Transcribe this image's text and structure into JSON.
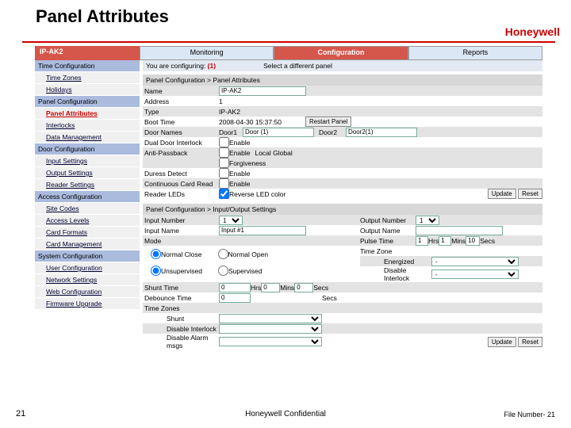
{
  "slide": {
    "title": "Panel Attributes",
    "brand": "Honeywell"
  },
  "topbar": {
    "ip": "IP-AK2",
    "monitoring": "Monitoring",
    "configuration": "Configuration",
    "reports": "Reports"
  },
  "sidebar": {
    "sec_time": "Time Configuration",
    "time_zones": "Time Zones",
    "holidays": "Holidays",
    "sec_panel": "Panel Configuration",
    "panel_attr": "Panel Attributes",
    "interlocks": "Interlocks",
    "data_mgmt": "Data Management",
    "sec_door": "Door Configuration",
    "input_settings": "Input Settings",
    "output_settings": "Output Settings",
    "reader_settings": "Reader Settings",
    "sec_access": "Access Configuration",
    "site_codes": "Site Codes",
    "access_levels": "Access Levels",
    "card_formats": "Card Formats",
    "card_mgmt": "Card Management",
    "sec_system": "System Configuration",
    "user_cfg": "User Configuration",
    "network": "Network Settings",
    "web_cfg": "Web Configuration",
    "firmware": "Firmware Upgrade"
  },
  "main": {
    "cfg_prefix": "You are configuring:",
    "cfg_id": "(1)",
    "select_diff": "Select a different panel",
    "crumb1": "Panel Configuration > Panel Attributes",
    "name_lbl": "Name",
    "name_val": "IP-AK2",
    "address_lbl": "Address",
    "address_val": "1",
    "type_lbl": "Type",
    "type_val": "IP-AK2",
    "boot_lbl": "Boot Time",
    "boot_val": "2008-04-30 15:37:50",
    "restart_btn": "Restart Panel",
    "doornames_lbl": "Door Names",
    "door1_lbl": "Door1",
    "door1_val": "Door (1)",
    "door2_lbl": "Door2",
    "door2_val": "Door2(1)",
    "dualdoor_lbl": "Dual Door Interlock",
    "dualdoor_chk": "Enable",
    "anti_lbl": "Anti-Passback",
    "anti_chk1": "Enable",
    "anti_chk2": "Forgiveness",
    "anti_sel": "Local   Global",
    "duress_lbl": "Duress Detect",
    "duress_chk": "Enable",
    "cont_lbl": "Continuous Card Read",
    "cont_chk": "Enable",
    "leds_lbl": "Reader LEDs",
    "leds_chk": "Reverse LED color",
    "update_btn": "Update",
    "reset_btn": "Reset",
    "crumb2": "Panel Configuration > Input/Output Settings",
    "in_num_lbl": "Input Number",
    "in_num_val": "1",
    "in_name_lbl": "Input Name",
    "in_name_val": "Input #1",
    "mode_lbl": "Mode",
    "nc": "Normal Close",
    "no": "Normal Open",
    "unsup": "Unsupervised",
    "sup": "Supervised",
    "out_num_lbl": "Output Number",
    "out_num_val": "1",
    "out_name_lbl": "Output Name",
    "pulse_lbl": "Pulse Time",
    "pulse_hrs": "1",
    "pulse_hrs_u": "Hrs",
    "pulse_mins": "1",
    "pulse_mins_u": "Mins",
    "pulse_secs": "10",
    "pulse_secs_u": "Secs",
    "tz_lbl": "Time Zone",
    "energized": "Energized",
    "dash": "-",
    "dis_inter": "Disable Interlock",
    "shunt_lbl": "Shunt Time",
    "shunt_hrs": "0",
    "hrs_u": "Hrs",
    "shunt_mins": "0",
    "mins_u": "Mins",
    "shunt_secs": "0",
    "secs_u": "Secs",
    "debounce_lbl": "Debounce Time",
    "debounce_val": "0",
    "tzs_lbl": "Time Zones",
    "tz_shunt": "Shunt",
    "tz_disint": "Disable Interlock",
    "tz_disalm": "Disable Alarm msgs",
    "update2_btn": "Update",
    "reset2_btn": "Reset"
  },
  "footer": {
    "pagenum": "21",
    "conf": "Honeywell Confidential",
    "filenum": "File Number- 21"
  }
}
